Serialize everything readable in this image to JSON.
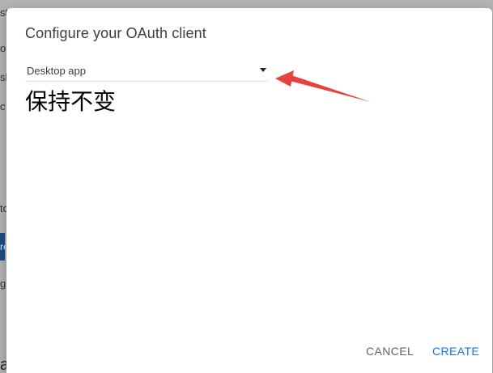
{
  "background": {
    "fragments": [
      "st",
      "o",
      "sk",
      "c",
      "to",
      "re",
      "g",
      "a"
    ]
  },
  "dialog": {
    "title": "Configure your OAuth client",
    "select": {
      "value": "Desktop app"
    },
    "annotation": "保持不变",
    "buttons": {
      "cancel": "CANCEL",
      "create": "CREATE"
    }
  },
  "colors": {
    "primary": "#1a73e8",
    "arrow": "#e8423c",
    "secondary_text": "#5f6368"
  }
}
